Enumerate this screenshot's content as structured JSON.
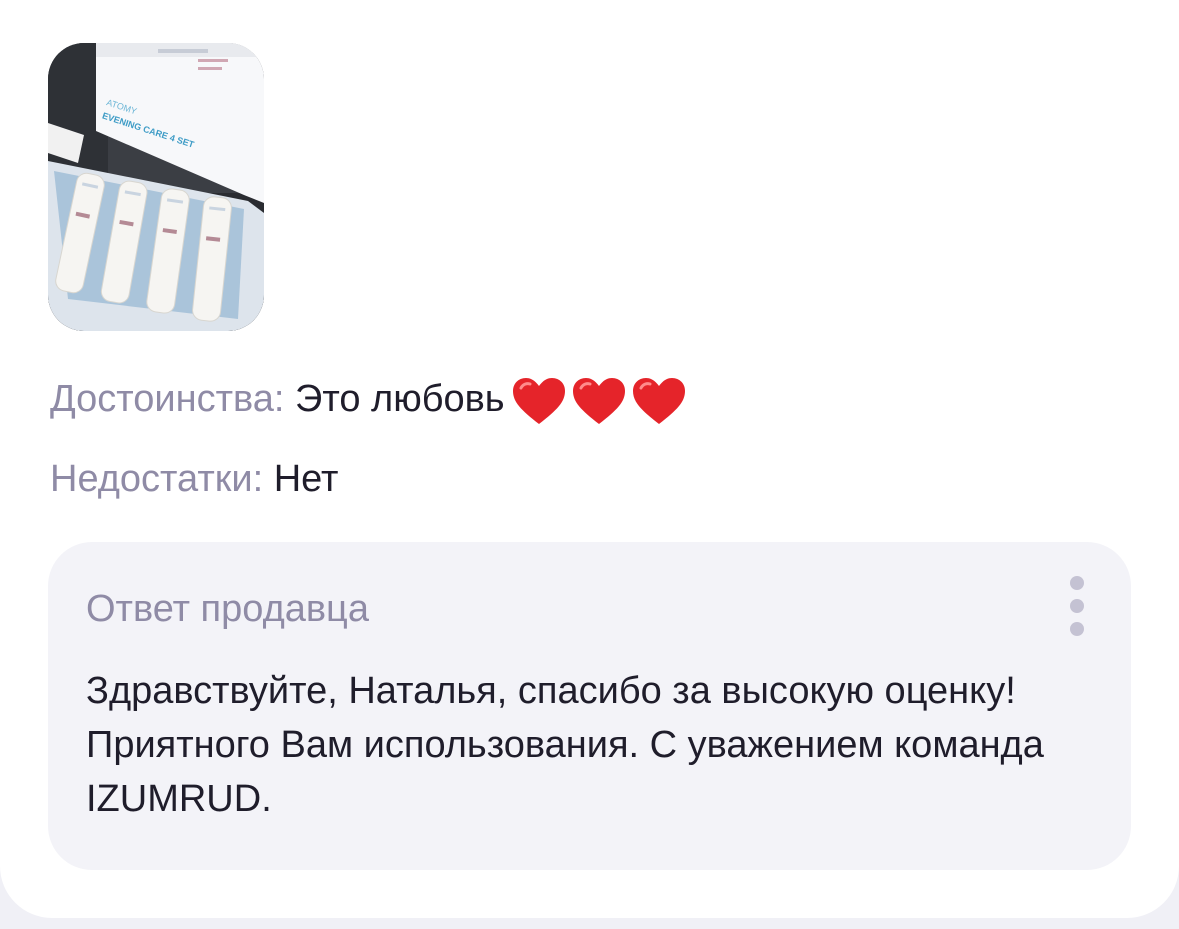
{
  "review": {
    "photo_alt": "Фото отзыва",
    "photo_text": {
      "brand": "ATOMY",
      "product": "EVENING CARE 4 SET"
    },
    "pros_label": "Достоинства:",
    "pros_value": "Это любовь",
    "pros_emoji": "heart-icon",
    "pros_emoji_count": 3,
    "cons_label": "Недостатки:",
    "cons_value": "Нет"
  },
  "seller_reply": {
    "title": "Ответ продавца",
    "text": "Здравствуйте, Наталья, спасибо за высокую оценку! Приятного Вам использования. С уважением команда IZUMRUD.",
    "menu_icon": "more-vertical-icon"
  },
  "colors": {
    "page_bg": "#f0f0f6",
    "card_bg": "#ffffff",
    "label_gray": "#8f8ba6",
    "text_dark": "#1f1d2b",
    "reply_bg": "#f3f3f8",
    "heart_red": "#e5242a"
  }
}
